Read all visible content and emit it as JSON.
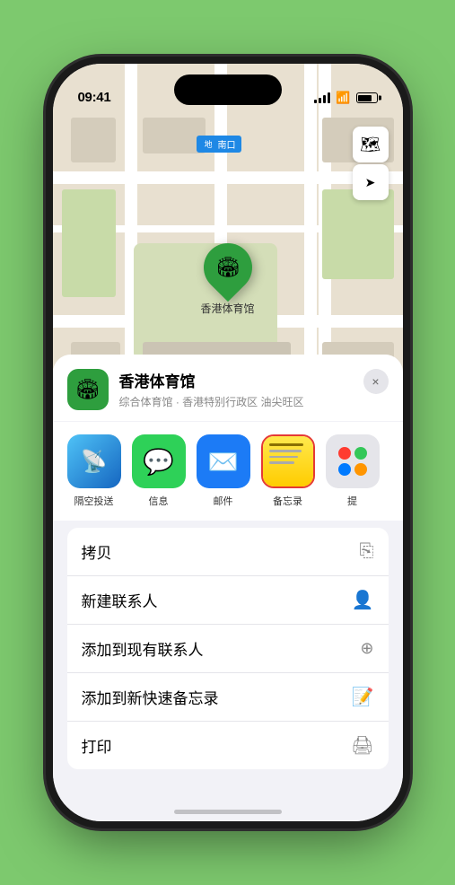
{
  "phone": {
    "time": "09:41",
    "dynamic_island": true
  },
  "map": {
    "metro_label": "南口",
    "metro_icon": "地",
    "marker_label": "香港体育馆",
    "controls": {
      "map_icon": "🗺",
      "location_icon": "⬆"
    }
  },
  "bottom_sheet": {
    "venue_name": "香港体育馆",
    "venue_subtitle": "综合体育馆 · 香港特别行政区 油尖旺区",
    "close_label": "×",
    "share_items": [
      {
        "label": "隔空投送",
        "type": "airdrop"
      },
      {
        "label": "信息",
        "type": "message"
      },
      {
        "label": "邮件",
        "type": "mail"
      },
      {
        "label": "备忘录",
        "type": "notes"
      },
      {
        "label": "提",
        "type": "more"
      }
    ],
    "actions": [
      {
        "label": "拷贝",
        "icon": "📋"
      },
      {
        "label": "新建联系人",
        "icon": "👤"
      },
      {
        "label": "添加到现有联系人",
        "icon": "👥"
      },
      {
        "label": "添加到新快速备忘录",
        "icon": "📝"
      },
      {
        "label": "打印",
        "icon": "🖨"
      }
    ]
  }
}
